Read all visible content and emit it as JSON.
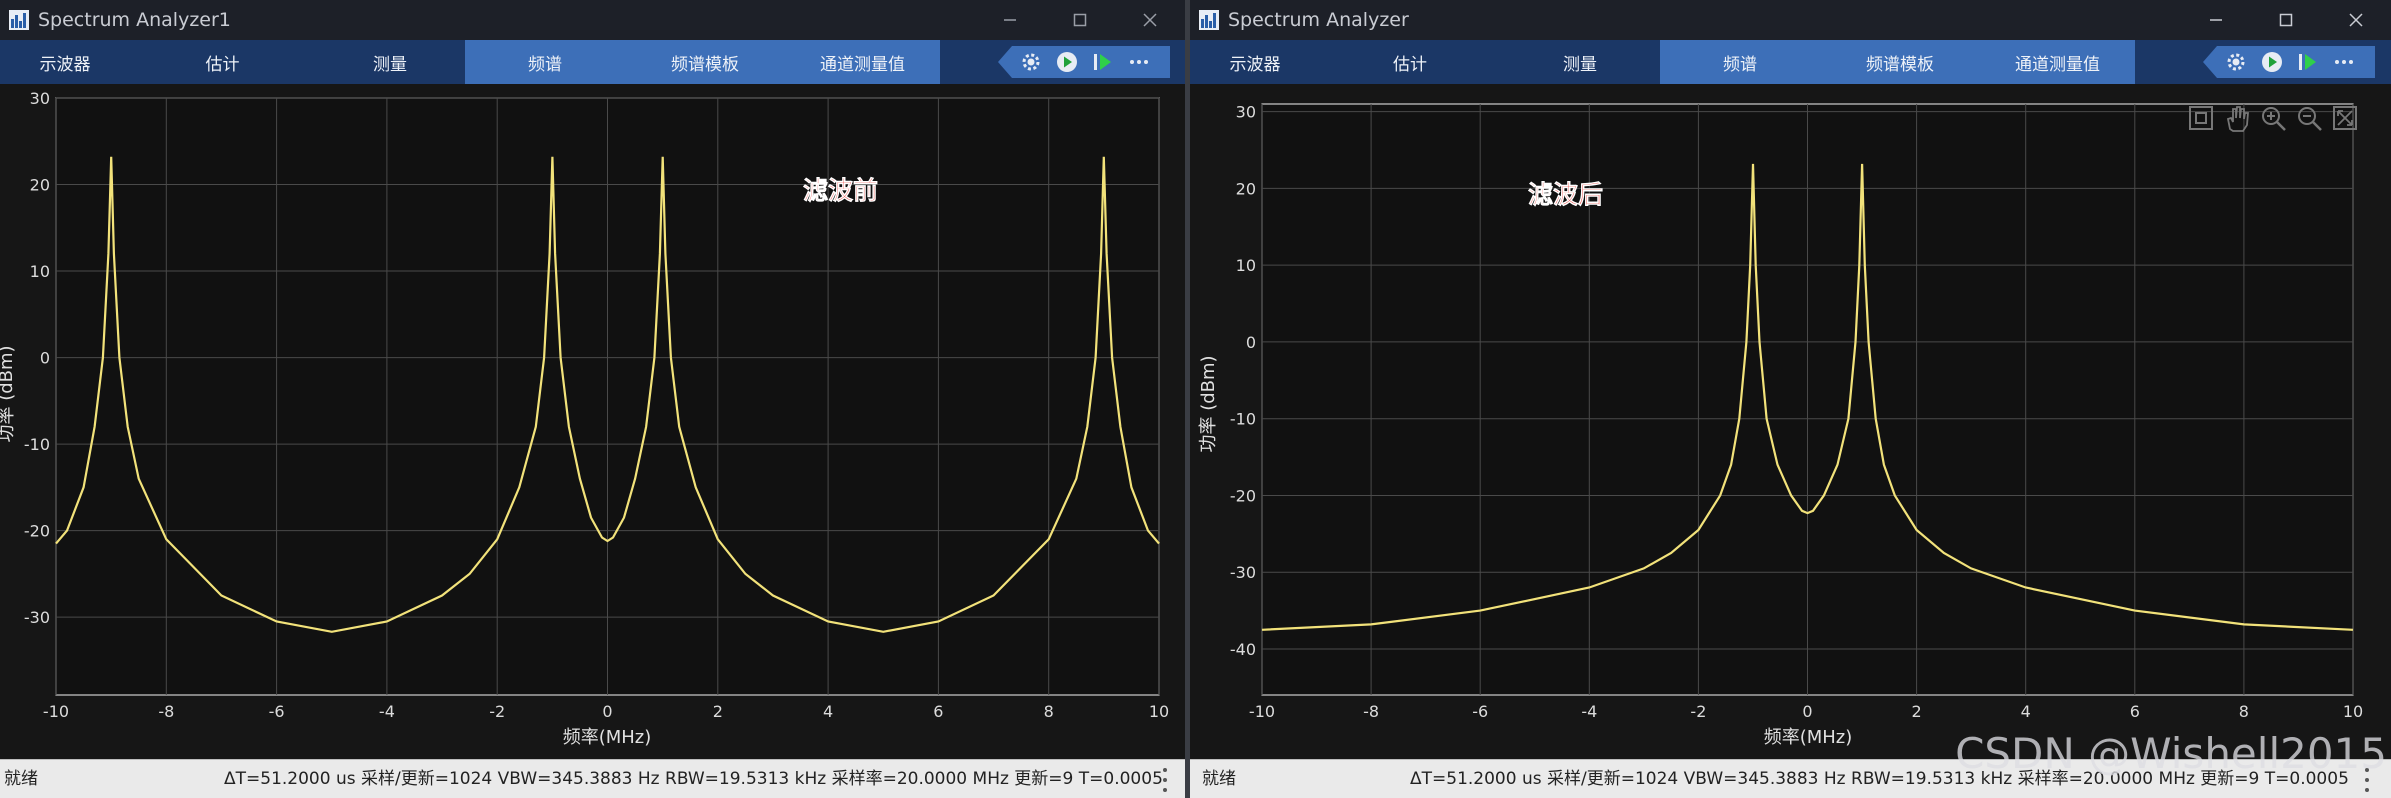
{
  "windows": [
    {
      "title": "Spectrum Analyzer1",
      "tabs": [
        {
          "label": "示波器",
          "active": false
        },
        {
          "label": "估计",
          "active": false
        },
        {
          "label": "测量",
          "active": false
        },
        {
          "label": "频谱",
          "active": true
        },
        {
          "label": "频谱模板",
          "active": true
        },
        {
          "label": "通道测量值",
          "active": true
        }
      ],
      "annotation": "滤波前",
      "status": {
        "left": "就绪",
        "right": "ΔT=51.2000 us  采样/更新=1024  VBW=345.3883 Hz  RBW=19.5313 kHz  采样率=20.0000 MHz  更新=9  T=0.0005"
      }
    },
    {
      "title": "Spectrum Analyzer",
      "tabs": [
        {
          "label": "示波器",
          "active": false
        },
        {
          "label": "估计",
          "active": false
        },
        {
          "label": "测量",
          "active": false
        },
        {
          "label": "频谱",
          "active": true
        },
        {
          "label": "频谱模板",
          "active": true
        },
        {
          "label": "通道测量值",
          "active": true
        }
      ],
      "annotation": "滤波后",
      "status": {
        "left": "就绪",
        "right": "ΔT=51.2000 us  采样/更新=1024  VBW=345.3883 Hz  RBW=19.5313 kHz  采样率=20.0000 MHz  更新=9  T=0.0005"
      }
    }
  ],
  "toolbar_icons": [
    "settings-icon",
    "run-icon",
    "step-forward-icon",
    "more-icon"
  ],
  "plot_tool_icons": [
    "zoom-to-fit-icon",
    "pan-hand-icon",
    "zoom-in-icon",
    "zoom-out-icon",
    "autoscale-icon"
  ],
  "watermark": "CSDN @Wishell2015",
  "colors": {
    "trace": "#f2e27a",
    "annotation": "#e8211b",
    "active_tab": "#3d6fb8",
    "toolstrip": "#1b3766",
    "plot_bg": "#161616"
  },
  "chart_data": [
    {
      "type": "line",
      "xlabel": "频率(MHz)",
      "ylabel": "功率 (dBm)",
      "xlim": [
        -10,
        10
      ],
      "ylim": [
        -39,
        30
      ],
      "xticks": [
        -10,
        -8,
        -6,
        -4,
        -2,
        0,
        2,
        4,
        6,
        8,
        10
      ],
      "yticks": [
        -30,
        -20,
        -10,
        0,
        10,
        20,
        30
      ],
      "grid": true,
      "series": [
        {
          "x": [
            -10,
            -9.8,
            -9.5,
            -9.3,
            -9.15,
            -9.05,
            -9,
            -8.95,
            -8.85,
            -8.7,
            -8.5,
            -8,
            -7,
            -6,
            -5,
            -4,
            -3,
            -2.5,
            -2,
            -1.6,
            -1.3,
            -1.15,
            -1.05,
            -1,
            -0.95,
            -0.85,
            -0.7,
            -0.5,
            -0.3,
            -0.1,
            0,
            0.1,
            0.3,
            0.5,
            0.7,
            0.85,
            0.95,
            1,
            1.05,
            1.15,
            1.3,
            1.6,
            2,
            2.5,
            3,
            4,
            5,
            6,
            7,
            8,
            8.5,
            8.7,
            8.85,
            8.95,
            9,
            9.05,
            9.15,
            9.3,
            9.5,
            9.8,
            10
          ],
          "y": [
            -21.5,
            -20,
            -15,
            -8,
            0,
            12,
            23.2,
            12,
            0,
            -8,
            -14,
            -21,
            -27.5,
            -30.5,
            -31.7,
            -30.5,
            -27.5,
            -25,
            -21,
            -15,
            -8,
            0,
            12,
            23.2,
            12,
            0,
            -8,
            -14,
            -18.5,
            -20.8,
            -21.2,
            -20.8,
            -18.5,
            -14,
            -8,
            0,
            12,
            23.2,
            12,
            0,
            -8,
            -15,
            -21,
            -25,
            -27.5,
            -30.5,
            -31.7,
            -30.5,
            -27.5,
            -21,
            -14,
            -8,
            0,
            12,
            23.2,
            12,
            0,
            -8,
            -15,
            -20,
            -21.5
          ]
        }
      ]
    },
    {
      "type": "line",
      "xlabel": "频率(MHz)",
      "ylabel": "功率 (dBm)",
      "xlim": [
        -10,
        10
      ],
      "ylim": [
        -46,
        31
      ],
      "xticks": [
        -10,
        -8,
        -6,
        -4,
        -2,
        0,
        2,
        4,
        6,
        8,
        10
      ],
      "yticks": [
        -40,
        -30,
        -20,
        -10,
        0,
        10,
        20,
        30
      ],
      "grid": true,
      "series": [
        {
          "x": [
            -10,
            -8,
            -6,
            -4,
            -3,
            -2.5,
            -2,
            -1.6,
            -1.4,
            -1.25,
            -1.12,
            -1.05,
            -1,
            -0.95,
            -0.88,
            -0.75,
            -0.55,
            -0.3,
            -0.1,
            0,
            0.1,
            0.3,
            0.55,
            0.75,
            0.88,
            0.95,
            1,
            1.05,
            1.12,
            1.25,
            1.4,
            1.6,
            2,
            2.5,
            3,
            4,
            6,
            8,
            10
          ],
          "y": [
            -37.5,
            -36.8,
            -35,
            -32,
            -29.5,
            -27.5,
            -24.5,
            -20,
            -16,
            -10,
            0,
            10,
            23.2,
            10,
            0,
            -10,
            -16,
            -20,
            -22,
            -22.3,
            -22,
            -20,
            -16,
            -10,
            0,
            10,
            23.2,
            10,
            0,
            -10,
            -16,
            -20,
            -24.5,
            -27.5,
            -29.5,
            -32,
            -35,
            -36.8,
            -37.5
          ]
        }
      ]
    }
  ]
}
